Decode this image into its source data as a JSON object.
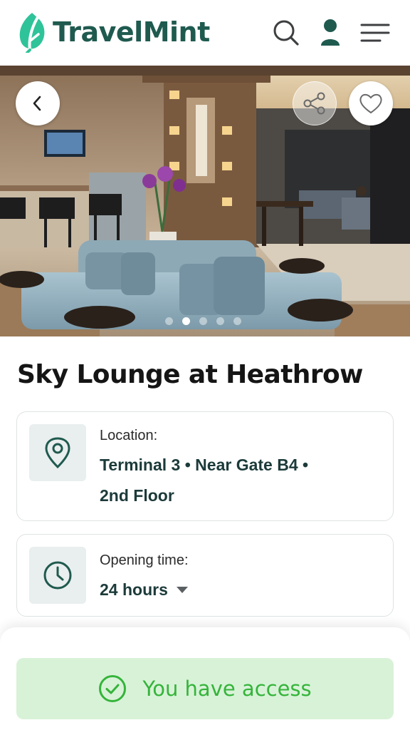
{
  "app": {
    "name": "TravelMint"
  },
  "colors": {
    "brand": "#1f5a4f",
    "brand_accent": "#2fc39a",
    "access_bg": "#d8f2d8",
    "access_text": "#35b43a"
  },
  "header": {
    "icons": [
      "search-icon",
      "user-icon",
      "menu-icon"
    ]
  },
  "hero": {
    "slide_count": 5,
    "active_slide": 2,
    "icons": [
      "chevron-left-icon",
      "share-icon",
      "heart-icon"
    ]
  },
  "lounge": {
    "title": "Sky Lounge at Heathrow"
  },
  "location": {
    "label": "Location:",
    "value": "Terminal 3 • Near Gate B4 • 2nd Floor",
    "icon": "map-pin-icon"
  },
  "opening": {
    "label": "Opening time:",
    "value": "24 hours",
    "icon": "clock-icon"
  },
  "access": {
    "label": "You have access",
    "icon": "check-circle-icon"
  }
}
